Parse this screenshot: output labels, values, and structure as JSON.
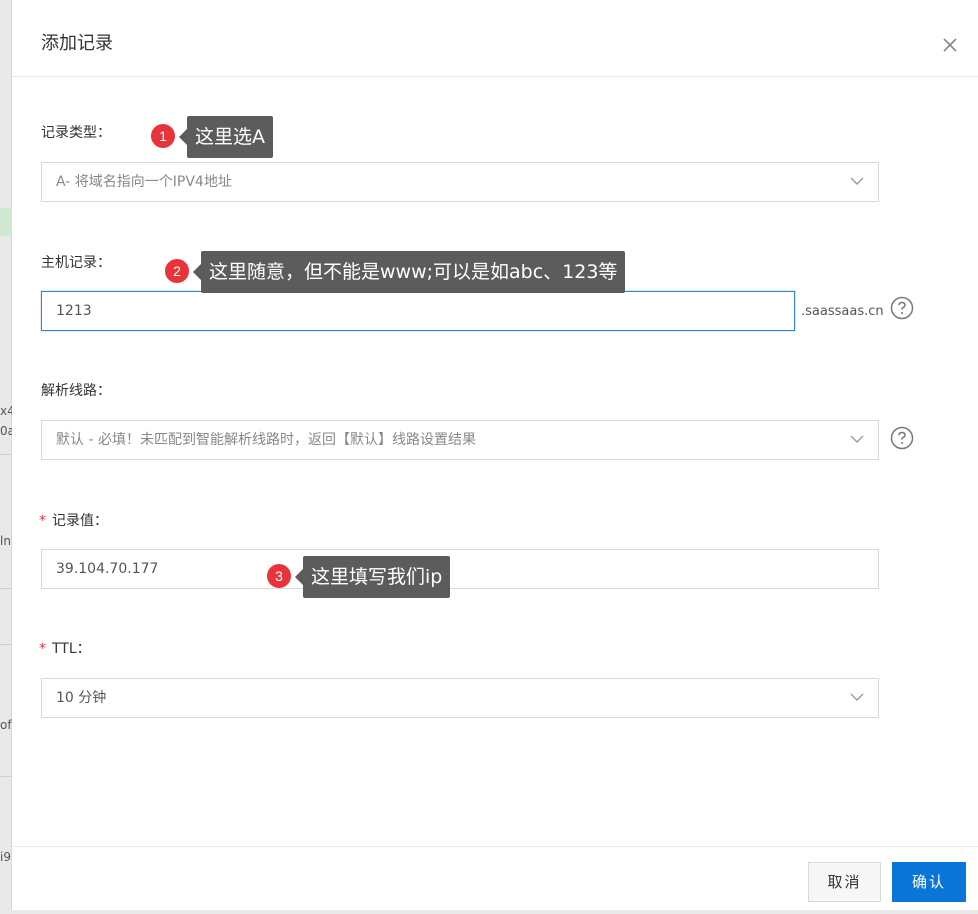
{
  "background": {
    "fragments": [
      "x4",
      "0a",
      "ln",
      "of",
      "i9"
    ]
  },
  "dialog": {
    "title": "添加记录",
    "close_icon": "close-icon"
  },
  "form": {
    "record_type": {
      "label": "记录类型：",
      "value": "A- 将域名指向一个IPV4地址"
    },
    "host_record": {
      "label": "主机记录：",
      "value": "1213",
      "suffix": ".saassaas.cn"
    },
    "resolve_line": {
      "label": "解析线路：",
      "value": "默认 - 必填！未匹配到智能解析线路时，返回【默认】线路设置结果"
    },
    "record_value": {
      "required_mark": "*",
      "label": "记录值：",
      "value": "39.104.70.177"
    },
    "ttl": {
      "required_mark": "*",
      "label": "TTL：",
      "value": "10 分钟"
    }
  },
  "annotations": [
    {
      "number": "1",
      "text": "这里选A"
    },
    {
      "number": "2",
      "text": "这里随意，但不能是www;可以是如abc、123等"
    },
    {
      "number": "3",
      "text": "这里填写我们ip"
    }
  ],
  "footer": {
    "cancel_label": "取消",
    "ok_label": "确认"
  },
  "colors": {
    "primary": "#0a75d9",
    "badge": "#e8333a",
    "tooltip": "#5c5c5c",
    "focus_border": "#2f86d8"
  }
}
